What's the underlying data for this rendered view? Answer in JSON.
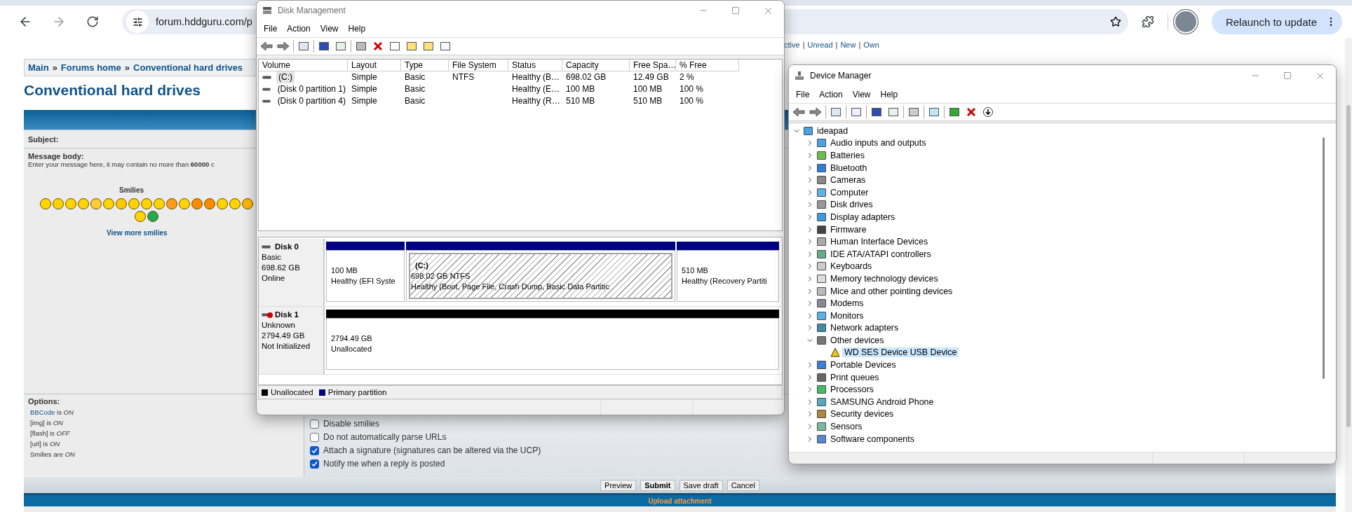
{
  "browser": {
    "url": "forum.hddguru.com/p",
    "relaunch": "Relaunch to update"
  },
  "forum": {
    "top_links": [
      "ctive",
      "Unread",
      "New",
      "Own"
    ],
    "top_separator": "|",
    "breadcrumbs": [
      "Main",
      "Forums home",
      "Conventional hard drives"
    ],
    "breadcrumb_separator": "»",
    "title": "Conventional hard drives",
    "subject_label": "Subject:",
    "body_label": "Message body:",
    "body_hint": "Enter your message here, it may contain no more than **60000** c",
    "smilies_title": "Smilies",
    "more_smilies": "View more smilies",
    "options_label": "Options:",
    "options": [
      {
        "kind": "link",
        "label": "BBCode",
        "rest": "is *ON*"
      },
      {
        "kind": "text",
        "label": "[img] is *ON*"
      },
      {
        "kind": "text",
        "label": "[flash] is *OFF*"
      },
      {
        "kind": "text",
        "label": "[url] is *ON*"
      },
      {
        "kind": "text",
        "label": "Smilies are *ON*"
      }
    ],
    "checkboxes": [
      {
        "label": "Disable smilies",
        "checked": false
      },
      {
        "label": "Do not automatically parse URLs",
        "checked": false
      },
      {
        "label": "Attach a signature (signatures can be altered via the UCP)",
        "checked": true
      },
      {
        "label": "Notify me when a reply is posted",
        "checked": true
      }
    ],
    "buttons": [
      {
        "label": "Preview",
        "kind": "normal"
      },
      {
        "label": "Submit",
        "kind": "primary"
      },
      {
        "label": "Save draft",
        "kind": "normal"
      },
      {
        "label": "Cancel",
        "kind": "normal"
      }
    ],
    "footer": "Upload attachment"
  },
  "disk_management": {
    "title": "Disk Management",
    "menu": [
      "File",
      "Action",
      "View",
      "Help"
    ],
    "columns": [
      "Volume",
      "Layout",
      "Type",
      "File System",
      "Status",
      "Capacity",
      "Free Spa…",
      "% Free"
    ],
    "rows": [
      {
        "selected": true,
        "cells": [
          "(C:)",
          "Simple",
          "Basic",
          "NTFS",
          "Healthy (B…",
          "698.02 GB",
          "12.49 GB",
          "2 %"
        ]
      },
      {
        "selected": false,
        "cells": [
          "(Disk 0 partition 1)",
          "Simple",
          "Basic",
          "",
          "Healthy (E…",
          "100 MB",
          "100 MB",
          "100 %"
        ]
      },
      {
        "selected": false,
        "cells": [
          "(Disk 0 partition 4)",
          "Simple",
          "Basic",
          "",
          "Healthy (R…",
          "510 MB",
          "510 MB",
          "100 %"
        ]
      }
    ],
    "disks": [
      {
        "name": "Disk 0",
        "kind": "online",
        "info": [
          "Basic",
          "698.62 GB",
          "Online"
        ],
        "partitions": [
          {
            "kind": "primary",
            "selected": false,
            "size": "100 MB",
            "status": "Healthy (EFI Syste"
          },
          {
            "kind": "primary",
            "selected": true,
            "label": "(C:)",
            "size": "698.02 GB NTFS",
            "status": "Healthy (Boot, Page File, Crash Dump, Basic Data Partitic"
          },
          {
            "kind": "primary",
            "selected": false,
            "size": "510 MB",
            "status": "Healthy (Recovery Partiti"
          }
        ]
      },
      {
        "name": "Disk 1",
        "kind": "not_initialized",
        "info": [
          "Unknown",
          "2794.49 GB",
          "Not Initialized"
        ],
        "partitions": [
          {
            "kind": "unallocated",
            "selected": false,
            "size": "2794.49 GB",
            "status": "Unallocated"
          }
        ]
      }
    ],
    "legend": [
      {
        "label": "Unallocated",
        "color": "#000000"
      },
      {
        "label": "Primary partition",
        "color": "#000080"
      }
    ]
  },
  "device_manager": {
    "title": "Device Manager",
    "menu": [
      "File",
      "Action",
      "View",
      "Help"
    ],
    "tree": [
      {
        "label": "ideapad",
        "expanded": true,
        "selected": false,
        "children": [
          {
            "label": "Audio inputs and outputs",
            "expanded": false,
            "selected": false
          },
          {
            "label": "Batteries",
            "expanded": false,
            "selected": false
          },
          {
            "label": "Bluetooth",
            "expanded": false,
            "selected": false
          },
          {
            "label": "Cameras",
            "expanded": false,
            "selected": false
          },
          {
            "label": "Computer",
            "expanded": false,
            "selected": false
          },
          {
            "label": "Disk drives",
            "expanded": false,
            "selected": false
          },
          {
            "label": "Display adapters",
            "expanded": false,
            "selected": false
          },
          {
            "label": "Firmware",
            "expanded": false,
            "selected": false
          },
          {
            "label": "Human Interface Devices",
            "expanded": false,
            "selected": false
          },
          {
            "label": "IDE ATA/ATAPI controllers",
            "expanded": false,
            "selected": false
          },
          {
            "label": "Keyboards",
            "expanded": false,
            "selected": false
          },
          {
            "label": "Memory technology devices",
            "expanded": false,
            "selected": false
          },
          {
            "label": "Mice and other pointing devices",
            "expanded": false,
            "selected": false
          },
          {
            "label": "Modems",
            "expanded": false,
            "selected": false
          },
          {
            "label": "Monitors",
            "expanded": false,
            "selected": false
          },
          {
            "label": "Network adapters",
            "expanded": false,
            "selected": false
          },
          {
            "label": "Other devices",
            "expanded": true,
            "selected": false,
            "children": [
              {
                "label": "WD SES Device USB Device",
                "selected": true,
                "kind": "warning"
              }
            ]
          },
          {
            "label": "Portable Devices",
            "expanded": false,
            "selected": false
          },
          {
            "label": "Print queues",
            "expanded": false,
            "selected": false
          },
          {
            "label": "Processors",
            "expanded": false,
            "selected": false
          },
          {
            "label": "SAMSUNG Android Phone",
            "expanded": false,
            "selected": false
          },
          {
            "label": "Security devices",
            "expanded": false,
            "selected": false
          },
          {
            "label": "Sensors",
            "expanded": false,
            "selected": false
          },
          {
            "label": "Software components",
            "expanded": false,
            "selected": false
          }
        ]
      }
    ]
  }
}
